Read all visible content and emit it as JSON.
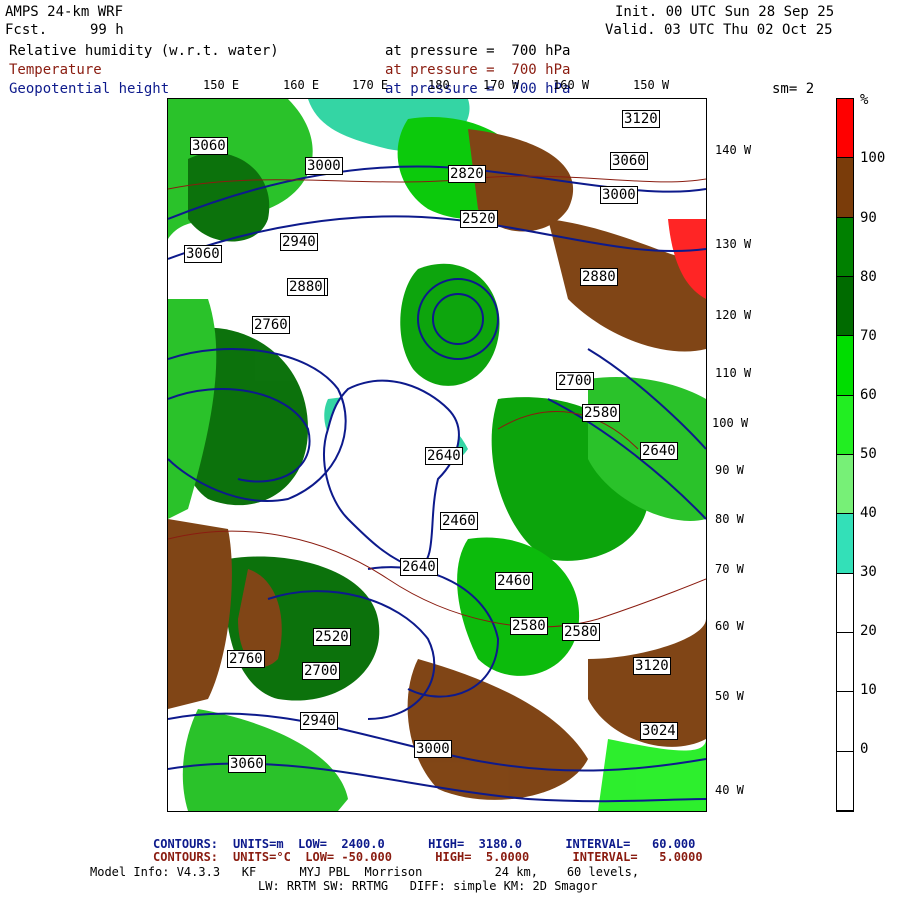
{
  "header": {
    "model": "AMPS 24-km WRF",
    "fcst_label": "Fcst.",
    "fcst_value": "99 h",
    "init": "Init. 00 UTC Sun 28 Sep 25",
    "valid": "Valid. 03 UTC Thu 02 Oct 25"
  },
  "fields": [
    {
      "name": "Relative humidity (w.r.t. water)",
      "level": "at pressure =  700 hPa",
      "color": "#000000"
    },
    {
      "name": "Temperature",
      "level": "at pressure =  700 hPa",
      "color": "#8a1c10"
    },
    {
      "name": "Geopotential height",
      "level": "at pressure =  700 hPa",
      "color": "#0d1a8c"
    }
  ],
  "smoothing": "sm= 2",
  "top_lon_labels": [
    "150 E",
    "160 E",
    "170 E",
    "180",
    "170 W",
    "160 W",
    "150 W"
  ],
  "right_lon_labels": [
    "140 W",
    "130 W",
    "120 W",
    "110 W",
    "100 W",
    "90 W",
    "80 W",
    "70 W",
    "60 W",
    "50 W",
    "40 W"
  ],
  "contour_labels": [
    "3120",
    "3060",
    "3000",
    "2940",
    "2880",
    "2820",
    "2760",
    "2700",
    "2640",
    "2580",
    "2520",
    "2460",
    "3060",
    "3000",
    "2940",
    "2880",
    "3120",
    "3060",
    "3024",
    "2640",
    "2580",
    "2700",
    "2760",
    "3000",
    "3060",
    "2880",
    "2520",
    "2460",
    "2580",
    "2640"
  ],
  "colorbar": {
    "unit": "%",
    "labels": [
      "100",
      "90",
      "80",
      "70",
      "60",
      "50",
      "40",
      "30",
      "20",
      "10",
      "0"
    ],
    "bands": [
      {
        "color": "#ff0000"
      },
      {
        "color": "#7a3c0a"
      },
      {
        "color": "#008000"
      },
      {
        "color": "#006b00"
      },
      {
        "color": "#00dd00"
      },
      {
        "color": "#22ee22"
      },
      {
        "color": "#77f077"
      },
      {
        "color": "#33e0b8"
      },
      {
        "color": "#ffffff"
      },
      {
        "color": "#ffffff"
      },
      {
        "color": "#ffffff"
      },
      {
        "color": "#ffffff"
      }
    ]
  },
  "footer": {
    "contours1_label": "CONTOURS:",
    "contours1": "UNITS=m  LOW=  2400.0      HIGH=  3180.0      INTERVAL=   60.000",
    "contours2_label": "CONTOURS:",
    "contours2": "UNITS=°C  LOW= -50.000      HIGH=  5.0000      INTERVAL=   5.0000",
    "model_info": "Model Info: V4.3.3   KF      MYJ PBL  Morrison          24 km,    60 levels,",
    "model_info2": "LW: RRTM SW: RRTMG   DIFF: simple KM: 2D Smagor"
  }
}
